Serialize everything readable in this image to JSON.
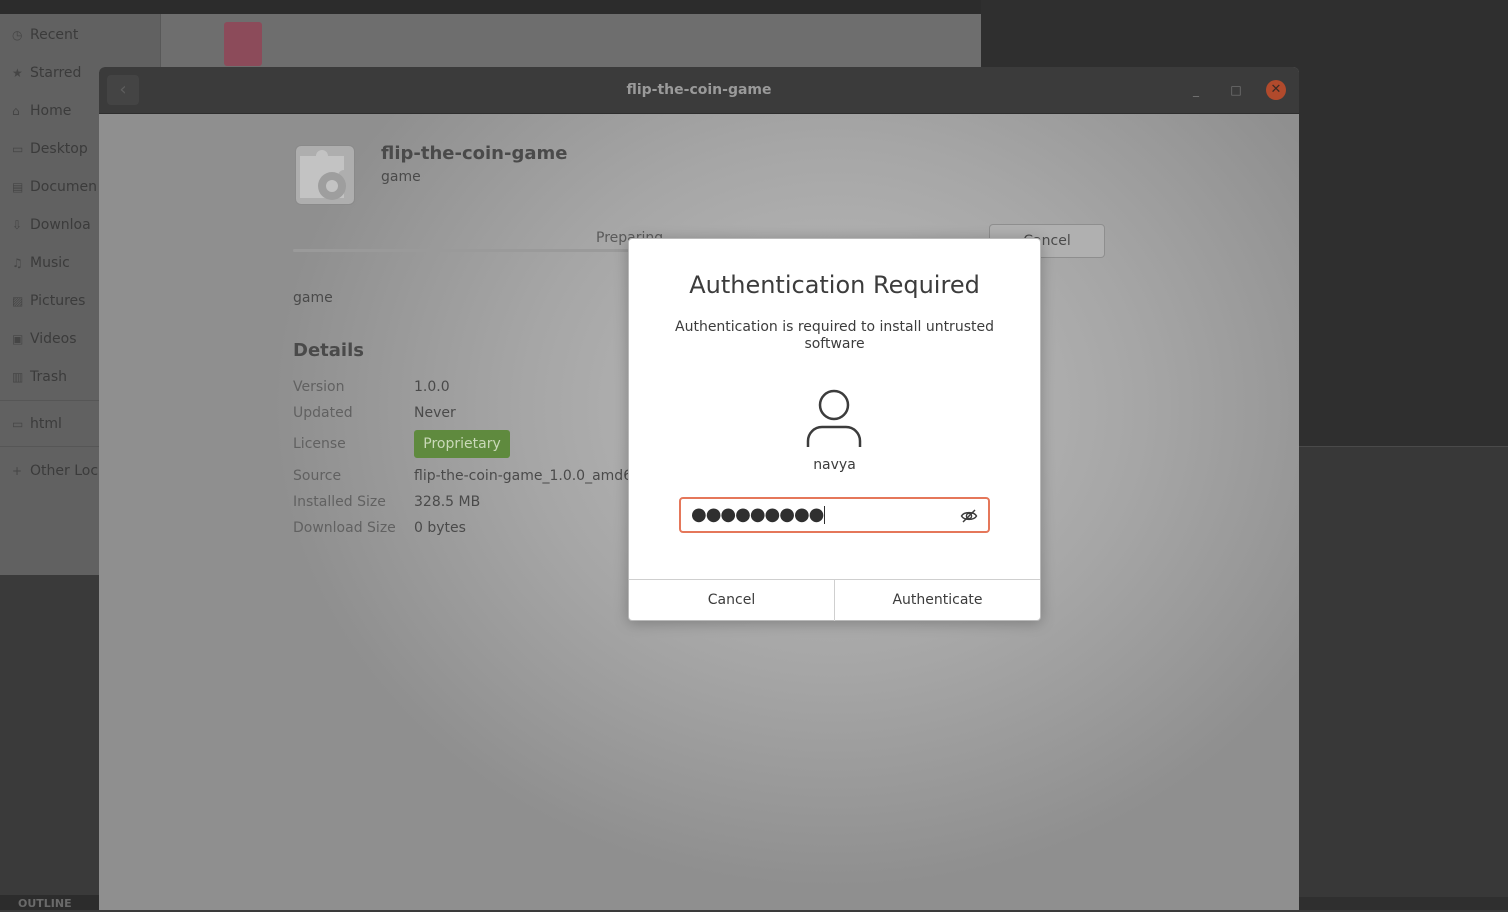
{
  "files_sidebar": {
    "items": [
      {
        "icon": "clock-icon",
        "glyph": "◷",
        "label": "Recent"
      },
      {
        "icon": "star-icon",
        "glyph": "★",
        "label": "Starred"
      },
      {
        "icon": "home-icon",
        "glyph": "⌂",
        "label": "Home"
      },
      {
        "icon": "desktop-icon",
        "glyph": "▭",
        "label": "Desktop"
      },
      {
        "icon": "document-icon",
        "glyph": "▤",
        "label": "Documen"
      },
      {
        "icon": "download-icon",
        "glyph": "⇩",
        "label": "Downloa"
      },
      {
        "icon": "music-icon",
        "glyph": "♫",
        "label": "Music"
      },
      {
        "icon": "picture-icon",
        "glyph": "▨",
        "label": "Pictures"
      },
      {
        "icon": "video-icon",
        "glyph": "▣",
        "label": "Videos"
      },
      {
        "icon": "trash-icon",
        "glyph": "▥",
        "label": "Trash"
      },
      {
        "icon": "folder-icon",
        "glyph": "▭",
        "label": "html"
      },
      {
        "icon": "plus-icon",
        "glyph": "+",
        "label": "Other Loc"
      }
    ],
    "outline_label": "OUTLINE"
  },
  "software_window": {
    "title": "flip-the-coin-game",
    "back_glyph": "‹",
    "minimize_glyph": "_",
    "maximize_glyph": "□",
    "close_glyph": "✕",
    "app_name": "flip-the-coin-game",
    "app_subtitle": "game",
    "progress_label": "Preparing",
    "progress_fraction": 0.3,
    "cancel_label": "Cancel",
    "summary": "game",
    "details_heading": "Details",
    "details": {
      "version_label": "Version",
      "version_value": "1.0.0",
      "updated_label": "Updated",
      "updated_value": "Never",
      "license_label": "License",
      "license_value": "Proprietary",
      "source_label": "Source",
      "source_value": "flip-the-coin-game_1.0.0_amd64",
      "installed_size_label": "Installed Size",
      "installed_size_value": "328.5 MB",
      "download_size_label": "Download Size",
      "download_size_value": "0 bytes"
    }
  },
  "auth_dialog": {
    "title": "Authentication Required",
    "message": "Authentication is required to install untrusted software",
    "username": "navya",
    "password_masked": "●●●●●●●●●",
    "cancel_label": "Cancel",
    "authenticate_label": "Authenticate",
    "focus_color": "#e5775a"
  }
}
